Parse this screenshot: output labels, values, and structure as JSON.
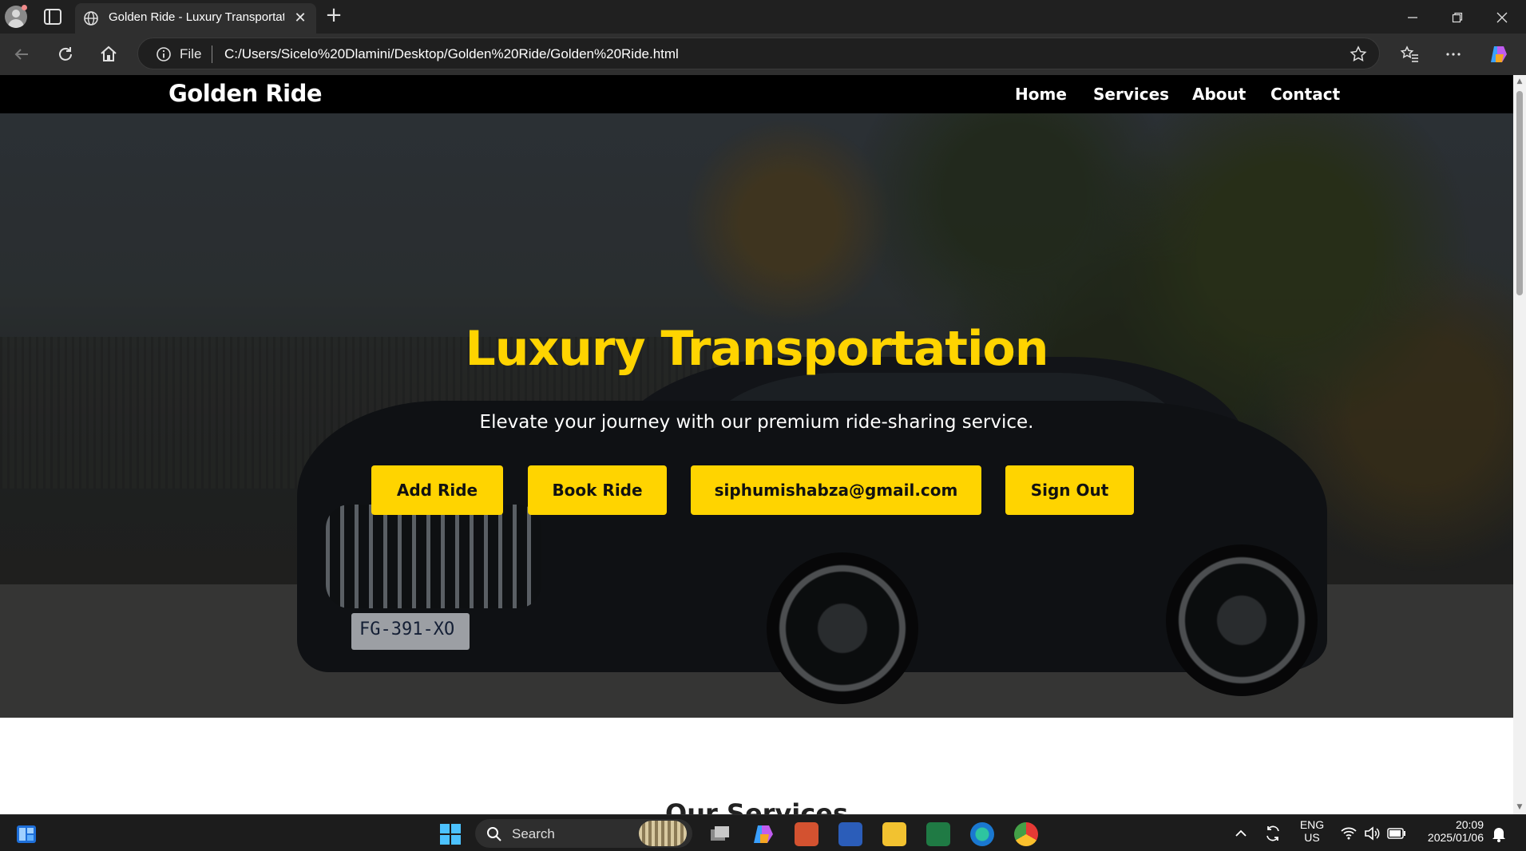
{
  "browser": {
    "tab_title": "Golden Ride - Luxury Transportati",
    "address_scheme": "File",
    "url": "C:/Users/Sicelo%20Dlamini/Desktop/Golden%20Ride/Golden%20Ride.html",
    "new_tab_glyph": "+",
    "close_glyph": "✕",
    "icons": [
      "profile-icon",
      "tab-actions-icon",
      "globe-icon",
      "back-icon",
      "refresh-icon",
      "home-icon",
      "info-icon",
      "favorite-star-icon",
      "favorites-icon",
      "more-icon",
      "copilot-icon"
    ]
  },
  "site": {
    "brand": "Golden Ride",
    "nav": [
      "Home",
      "Services",
      "About",
      "Contact"
    ],
    "hero": {
      "title": "Luxury Transportation",
      "subtitle": "Elevate your journey with our premium ride-sharing service.",
      "plate": "FG-391-XO",
      "buttons": [
        "Add Ride",
        "Book Ride",
        "siphumishabza@gmail.com",
        "Sign Out"
      ]
    },
    "next_section_title": "Our Services",
    "colors": {
      "accent": "#ffd400",
      "nav_bg": "#000000",
      "button_text": "#111111"
    }
  },
  "taskbar": {
    "search_label": "Search",
    "lang_line1": "ENG",
    "lang_line2": "US",
    "time": "20:09",
    "date": "2025/01/06",
    "apps": [
      "start-icon",
      "task-view-icon",
      "copilot-icon",
      "powerpoint-icon",
      "word-icon",
      "file-explorer-icon",
      "excel-icon",
      "edge-icon",
      "chrome-icon"
    ]
  }
}
